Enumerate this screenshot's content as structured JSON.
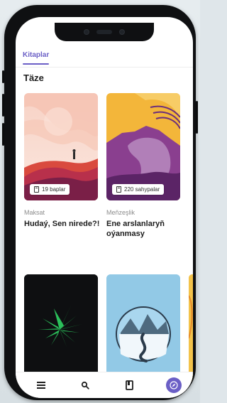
{
  "header": {
    "tab_label": "Kitaplar"
  },
  "section": {
    "title": "Täze"
  },
  "books": [
    {
      "category": "Maksat",
      "title": "Hudaý, Sen nirede?!",
      "badge": "19 baplar"
    },
    {
      "category": "Meňzeşlik",
      "title": "Ene arslanlaryň oýanmasy",
      "badge": "220 sahypalar"
    }
  ],
  "colors": {
    "accent": "#6b5fc6"
  },
  "nav": {
    "items": [
      "menu-icon",
      "search-icon",
      "bookmark-icon",
      "compass-icon"
    ]
  }
}
